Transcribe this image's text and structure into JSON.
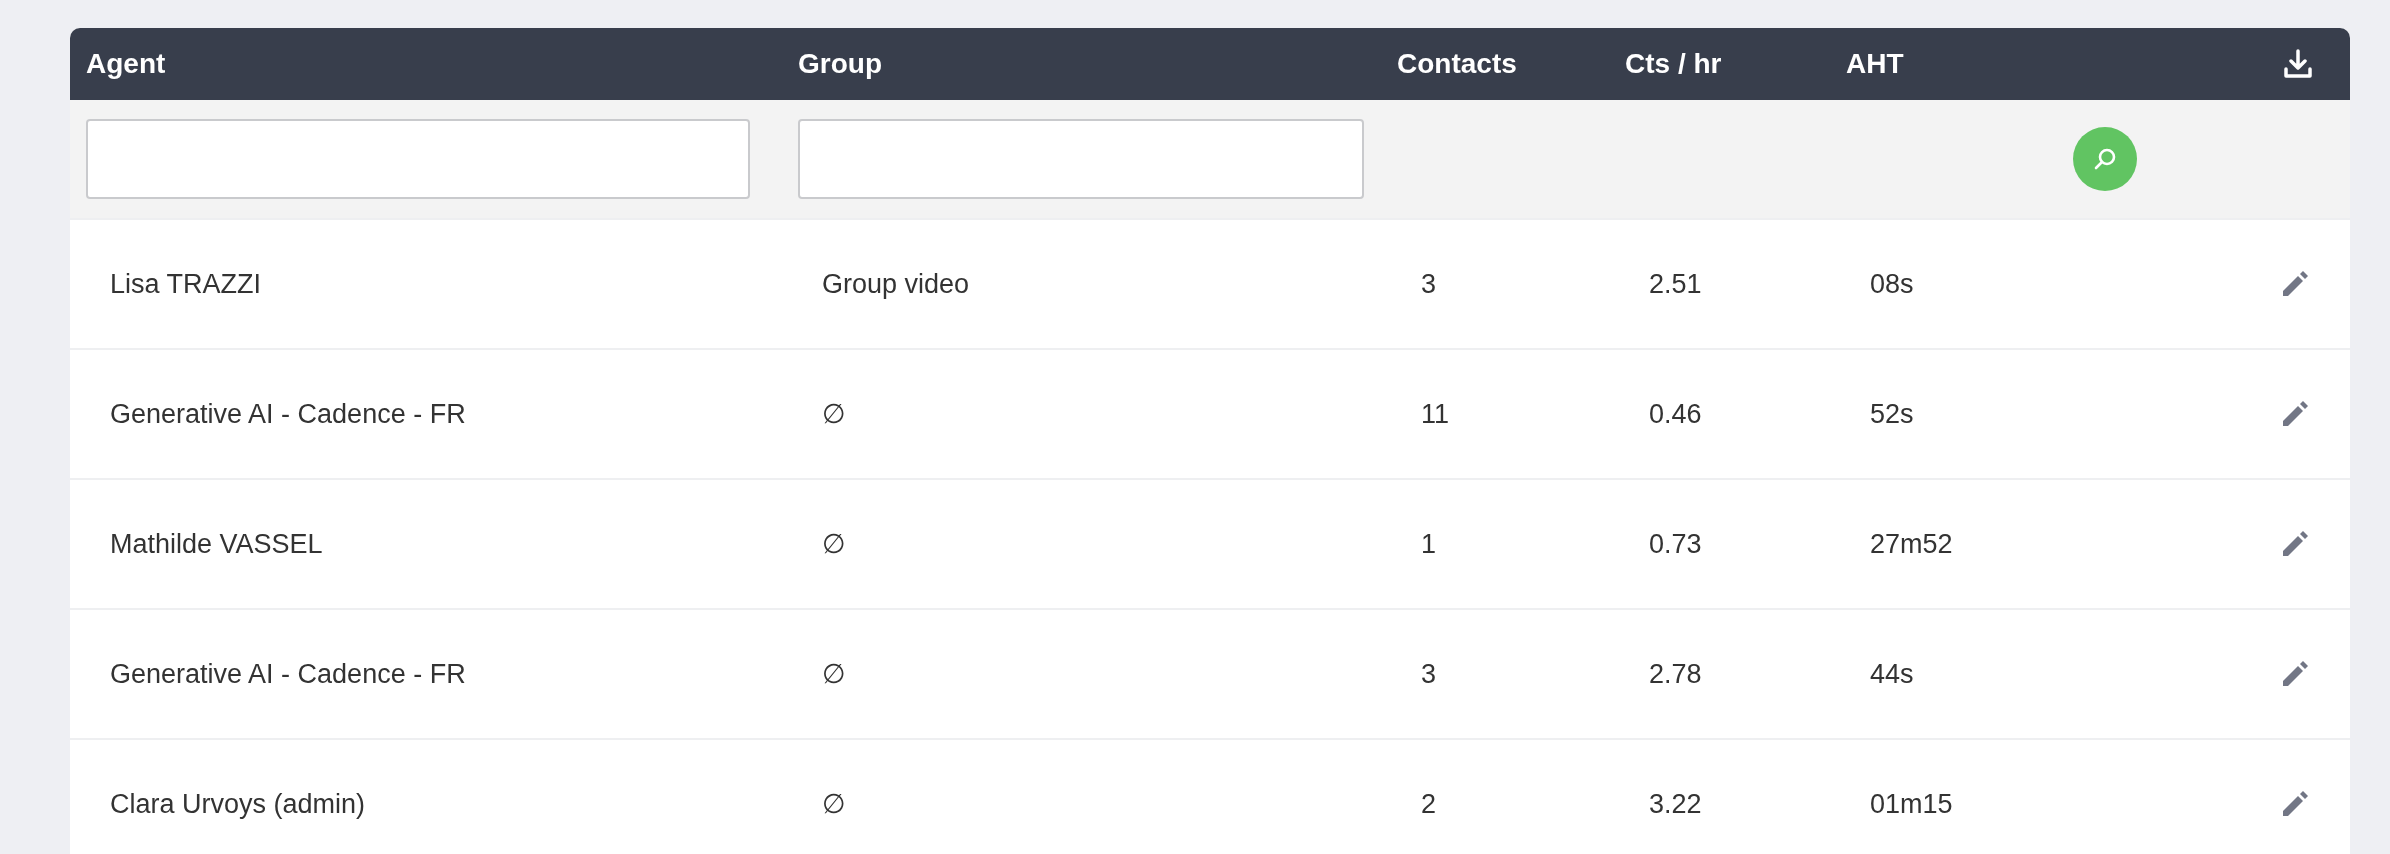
{
  "table": {
    "columns": [
      "Agent",
      "Group",
      "Contacts",
      "Cts / hr",
      "AHT"
    ],
    "rows": [
      {
        "agent": "Lisa TRAZZI",
        "group": "Group video",
        "contacts": "3",
        "cts_per_hr": "2.51",
        "aht": "08s"
      },
      {
        "agent": "Generative AI - Cadence - FR",
        "group": "∅",
        "contacts": "11",
        "cts_per_hr": "0.46",
        "aht": "52s"
      },
      {
        "agent": "Mathilde VASSEL",
        "group": "∅",
        "contacts": "1",
        "cts_per_hr": "0.73",
        "aht": "27m52"
      },
      {
        "agent": "Generative AI - Cadence - FR",
        "group": "∅",
        "contacts": "3",
        "cts_per_hr": "2.78",
        "aht": "44s"
      },
      {
        "agent": "Clara Urvoys (admin)",
        "group": "∅",
        "contacts": "2",
        "cts_per_hr": "3.22",
        "aht": "01m15"
      }
    ]
  }
}
